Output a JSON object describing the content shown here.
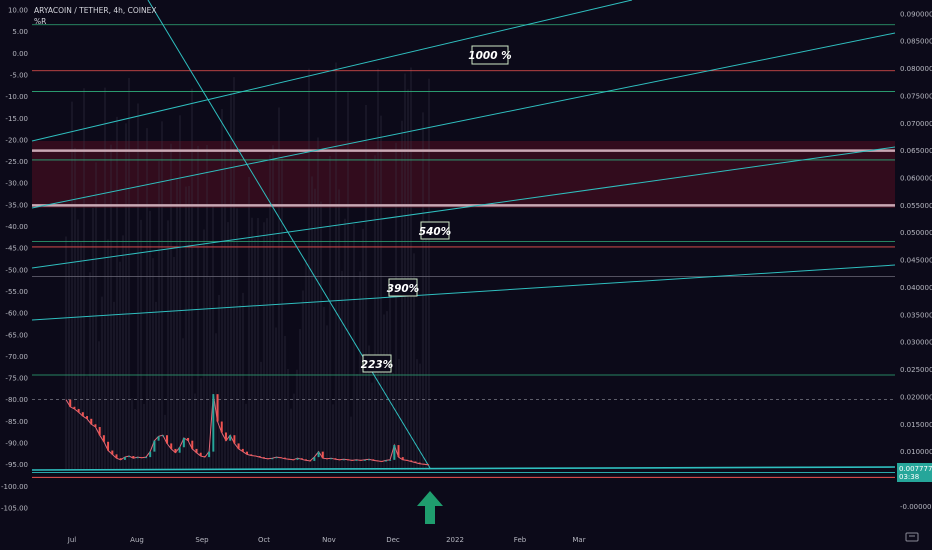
{
  "header": {
    "title": "ARYACOIN / TETHER, 4h, COINEX",
    "subtitle": "%R"
  },
  "chart_data": {
    "type": "line",
    "x": [
      "Jul",
      "Aug",
      "Sep",
      "Oct",
      "Nov",
      "Dec",
      "2022",
      "Feb",
      "Mar"
    ],
    "left_axis": {
      "ticks": [
        "10.00",
        "5.00",
        "0.00",
        "-5.00",
        "-10.00",
        "-15.00",
        "-20.00",
        "-25.00",
        "-30.00",
        "-35.00",
        "-40.00",
        "-45.00",
        "-50.00",
        "-55.00",
        "-60.00",
        "-65.00",
        "-70.00",
        "-75.00",
        "-80.00",
        "-85.00",
        "-90.00",
        "-95.00",
        "-100.00",
        "-105.00"
      ],
      "ylim": [
        -105,
        10
      ]
    },
    "right_axis": {
      "ticks": [
        "0.090000",
        "0.085000",
        "0.080000",
        "0.075000",
        "0.070000",
        "0.065000",
        "0.060000",
        "0.055000",
        "0.050000",
        "0.045000",
        "0.040000",
        "0.035000",
        "0.030000",
        "0.025000",
        "0.020000",
        "0.015000",
        "0.010000",
        "0.005000",
        "-0.000000"
      ],
      "ylim": [
        -0.0003,
        0.0907
      ]
    },
    "series": [
      {
        "values": [
          0.0195,
          0.0182,
          0.0178,
          0.0172,
          0.0165,
          0.016,
          0.015,
          0.0145,
          0.013,
          0.0118,
          0.0102,
          0.0095,
          0.0088,
          0.0085,
          0.009,
          0.0092,
          0.0088,
          0.009,
          0.0089,
          0.009,
          0.01,
          0.012,
          0.0128,
          0.013,
          0.0115,
          0.0105,
          0.0098,
          0.0108,
          0.0125,
          0.012,
          0.0105,
          0.0098,
          0.0092,
          0.009,
          0.01,
          0.0205,
          0.0155,
          0.0135,
          0.012,
          0.013,
          0.0115,
          0.0105,
          0.01,
          0.0095,
          0.0093,
          0.0092,
          0.009,
          0.0088,
          0.0087,
          0.0088,
          0.009,
          0.0089,
          0.0087,
          0.0086,
          0.0085,
          0.0088,
          0.0086,
          0.0084,
          0.0083,
          0.009,
          0.01,
          0.0088,
          0.0087,
          0.0088,
          0.0086,
          0.0085,
          0.0086,
          0.0085,
          0.0084,
          0.0085,
          0.0084,
          0.0085,
          0.0086,
          0.0084,
          0.0083,
          0.0082,
          0.0084,
          0.0085,
          0.0112,
          0.009,
          0.0085,
          0.0084,
          0.0082,
          0.008,
          0.0078,
          0.0077,
          0.0076
        ]
      }
    ],
    "levels": [
      0.088,
      0.0796,
      0.0758,
      0.065,
      0.0633,
      0.055,
      0.0484,
      0.0474,
      0.042,
      0.024,
      0.0195,
      0.0062
    ],
    "zone": [
      0.055,
      0.065
    ],
    "annotations": [
      "1000 %",
      "540%",
      "390%",
      "223%"
    ],
    "price_badge": {
      "price": "0.007777",
      "countdown": "03:38"
    },
    "colors": {
      "background": "#0c0a19",
      "teal": "#2fbfbf",
      "green": "#26a69a",
      "red": "#ef5350",
      "zone": "#3a0d1f",
      "arrow": "#1f9e6e"
    }
  },
  "icons": {
    "logo": "tradingview-logo-icon",
    "arrow": "arrow-up-icon"
  }
}
